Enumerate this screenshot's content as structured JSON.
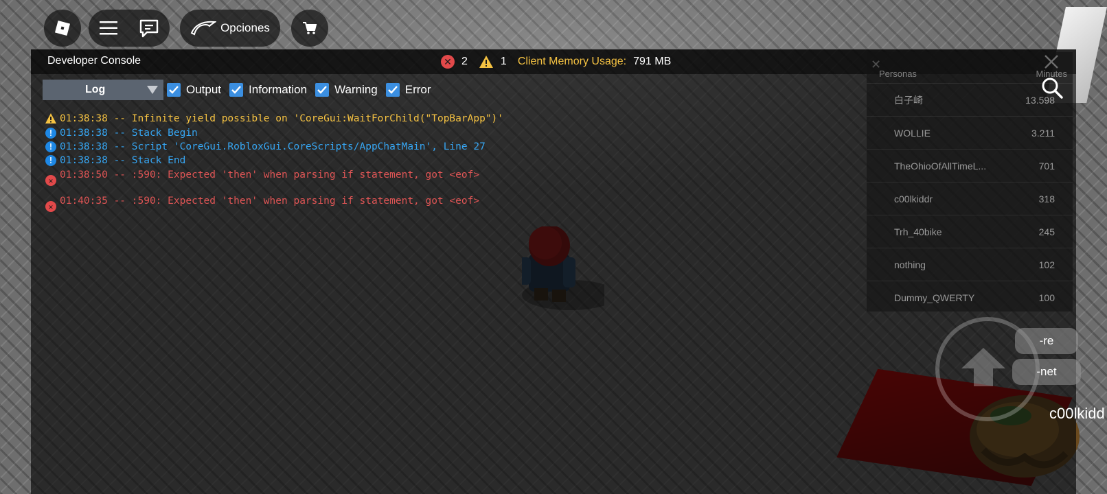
{
  "topbar": {
    "options_label": "Opciones"
  },
  "console": {
    "title": "Developer Console",
    "error_count": "2",
    "warning_count": "1",
    "memory_label": "Client Memory Usage:",
    "memory_value": "791 MB",
    "log_dropdown": "Log",
    "filters": [
      {
        "label": "Output",
        "checked": true
      },
      {
        "label": "Information",
        "checked": true
      },
      {
        "label": "Warning",
        "checked": true
      },
      {
        "label": "Error",
        "checked": true
      }
    ],
    "logs": [
      {
        "level": "warning",
        "text": "01:38:38 -- Infinite yield possible on 'CoreGui:WaitForChild(\"TopBarApp\")'"
      },
      {
        "level": "info",
        "text": "01:38:38 -- Stack Begin"
      },
      {
        "level": "info",
        "text": "01:38:38 -- Script 'CoreGui.RobloxGui.CoreScripts/AppChatMain', Line 27"
      },
      {
        "level": "info",
        "text": "01:38:38 -- Stack End"
      },
      {
        "level": "error",
        "text": "01:38:50 -- :590: Expected 'then' when parsing if statement, got <eof>"
      },
      {
        "level": "error",
        "text": "01:40:35 -- :590: Expected 'then' when parsing if statement, got <eof>"
      }
    ]
  },
  "leaderboard": {
    "col_players": "Personas",
    "col_minutes": "Minutes",
    "rows": [
      {
        "name": "白子崎",
        "minutes": "13.598"
      },
      {
        "name": "WOLLIE",
        "minutes": "3.211"
      },
      {
        "name": "TheOhioOfAllTimeL...",
        "minutes": "701"
      },
      {
        "name": "c00lkiddr",
        "minutes": "318"
      },
      {
        "name": "Trh_40bike",
        "minutes": "245"
      },
      {
        "name": "nothing",
        "minutes": "102"
      },
      {
        "name": "Dummy_QWERTY",
        "minutes": "100"
      }
    ]
  },
  "controls": {
    "emote_re": "-re",
    "emote_net": "-net"
  },
  "scene": {
    "player_name_tag": "c00lkidd"
  },
  "colors": {
    "memory_label": "#f5c242",
    "warning": "#f5c242",
    "info": "#36a6f3",
    "error": "#e05555",
    "checkbox": "#3b8fe1",
    "dropdown": "#5b6470"
  }
}
